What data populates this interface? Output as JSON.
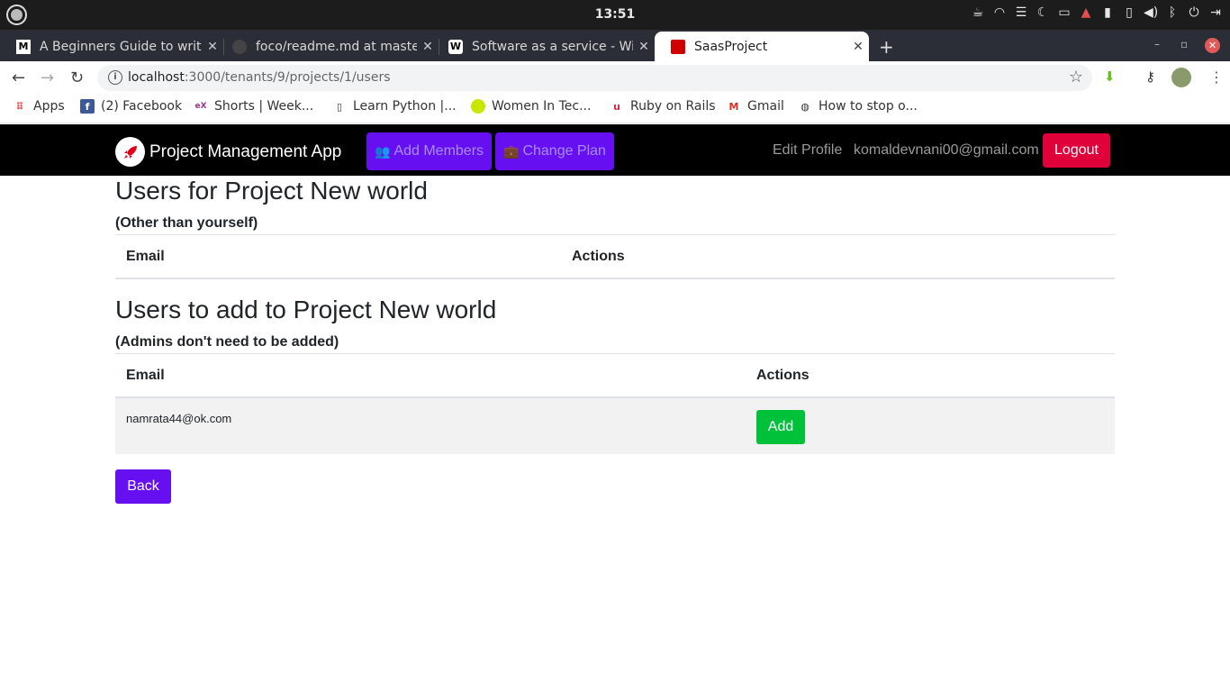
{
  "os": {
    "clock": "13:51"
  },
  "browser": {
    "tabs": [
      {
        "title": "A Beginners Guide to writ",
        "fav": "M"
      },
      {
        "title": "foco/readme.md at maste",
        "fav": ""
      },
      {
        "title": "Software as a service - Wik",
        "fav": "W"
      },
      {
        "title": "SaasProject",
        "fav": ""
      }
    ],
    "new_tab": "+",
    "url_host": "localhost",
    "url_path": ":3000/tenants/9/projects/1/users",
    "bookmarks": [
      {
        "label": "Apps"
      },
      {
        "label": "(2) Facebook"
      },
      {
        "label": "Shorts | Week..."
      },
      {
        "label": "Learn Python |..."
      },
      {
        "label": "Women In Tec..."
      },
      {
        "label": "Ruby on Rails"
      },
      {
        "label": "Gmail"
      },
      {
        "label": "How to stop o..."
      }
    ]
  },
  "navbar": {
    "brand": "Project Management App",
    "add_members": "Add Members",
    "change_plan": "Change Plan",
    "edit_profile": "Edit Profile",
    "user_email": "komaldevnani00@gmail.com",
    "logout": "Logout"
  },
  "project_users": {
    "title": "Users for Project New world",
    "subtitle": "(Other than yourself)",
    "columns": [
      "Email",
      "Actions"
    ]
  },
  "users_to_add": {
    "title": "Users to add to Project New world",
    "subtitle": "(Admins don't need to be added)",
    "columns": [
      "Email",
      "Actions"
    ],
    "rows": [
      {
        "email": "namrata44@ok.com",
        "action": "Add"
      }
    ]
  },
  "back_label": "Back",
  "colors": {
    "accent": "#6610f2",
    "danger": "#e0003a",
    "success": "#00c23a"
  }
}
